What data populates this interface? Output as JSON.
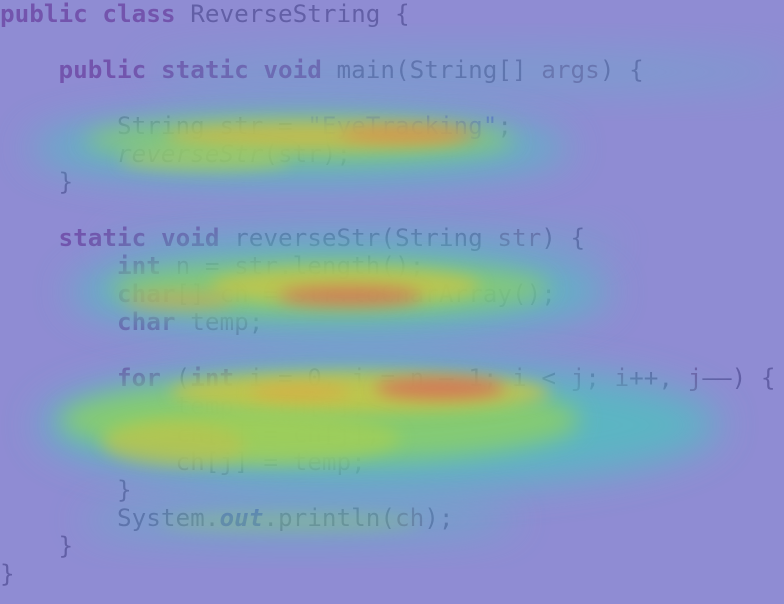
{
  "code": {
    "language": "java",
    "lines": [
      {
        "indent": "",
        "tokens": [
          {
            "t": "public",
            "k": "kw"
          },
          {
            "t": " "
          },
          {
            "t": "class",
            "k": "kw"
          },
          {
            "t": " ReverseString {"
          }
        ]
      },
      {
        "indent": "",
        "tokens": []
      },
      {
        "indent": "    ",
        "tokens": [
          {
            "t": "public",
            "k": "kw"
          },
          {
            "t": " "
          },
          {
            "t": "static",
            "k": "kw"
          },
          {
            "t": " "
          },
          {
            "t": "void",
            "k": "kw"
          },
          {
            "t": " main(String[] "
          },
          {
            "t": "args",
            "k": "var"
          },
          {
            "t": ") {"
          }
        ]
      },
      {
        "indent": "",
        "tokens": []
      },
      {
        "indent": "        ",
        "tokens": [
          {
            "t": "String "
          },
          {
            "t": "str",
            "k": "var"
          },
          {
            "t": " = "
          },
          {
            "t": "\"EyeTracking\"",
            "k": "str"
          },
          {
            "t": ";"
          }
        ]
      },
      {
        "indent": "        ",
        "tokens": [
          {
            "t": "reverseStr",
            "k": "it"
          },
          {
            "t": "("
          },
          {
            "t": "str",
            "k": "var"
          },
          {
            "t": ");"
          }
        ]
      },
      {
        "indent": "    ",
        "tokens": [
          {
            "t": "}"
          }
        ]
      },
      {
        "indent": "",
        "tokens": []
      },
      {
        "indent": "    ",
        "tokens": [
          {
            "t": "static",
            "k": "kw"
          },
          {
            "t": " "
          },
          {
            "t": "void",
            "k": "kw"
          },
          {
            "t": " reverseStr(String "
          },
          {
            "t": "str",
            "k": "var"
          },
          {
            "t": ") {"
          }
        ]
      },
      {
        "indent": "        ",
        "tokens": [
          {
            "t": "int",
            "k": "kw"
          },
          {
            "t": " "
          },
          {
            "t": "n",
            "k": "var"
          },
          {
            "t": " = "
          },
          {
            "t": "str",
            "k": "var"
          },
          {
            "t": ".length();"
          }
        ]
      },
      {
        "indent": "        ",
        "tokens": [
          {
            "t": "char",
            "k": "kw"
          },
          {
            "t": "[] "
          },
          {
            "t": "ch",
            "k": "var"
          },
          {
            "t": " = "
          },
          {
            "t": "str",
            "k": "var"
          },
          {
            "t": ".toCharArray();"
          }
        ]
      },
      {
        "indent": "        ",
        "tokens": [
          {
            "t": "char",
            "k": "kw"
          },
          {
            "t": " "
          },
          {
            "t": "temp",
            "k": "var"
          },
          {
            "t": ";"
          }
        ]
      },
      {
        "indent": "",
        "tokens": []
      },
      {
        "indent": "        ",
        "tokens": [
          {
            "t": "for",
            "k": "kw"
          },
          {
            "t": " ("
          },
          {
            "t": "int",
            "k": "kw"
          },
          {
            "t": " "
          },
          {
            "t": "i",
            "k": "var"
          },
          {
            "t": " = 0, "
          },
          {
            "t": "j",
            "k": "var"
          },
          {
            "t": " = "
          },
          {
            "t": "n",
            "k": "var"
          },
          {
            "t": " – 1; "
          },
          {
            "t": "i",
            "k": "var"
          },
          {
            "t": " < "
          },
          {
            "t": "j",
            "k": "var"
          },
          {
            "t": "; "
          },
          {
            "t": "i",
            "k": "var"
          },
          {
            "t": "++, "
          },
          {
            "t": "j",
            "k": "var"
          },
          {
            "t": "––) {"
          }
        ]
      },
      {
        "indent": "            ",
        "tokens": [
          {
            "t": "temp",
            "k": "var"
          },
          {
            "t": " = "
          },
          {
            "t": "ch",
            "k": "var"
          },
          {
            "t": "["
          },
          {
            "t": "i",
            "k": "var"
          },
          {
            "t": "];"
          }
        ]
      },
      {
        "indent": "            ",
        "tokens": [
          {
            "t": "ch",
            "k": "var"
          },
          {
            "t": "["
          },
          {
            "t": "i",
            "k": "var"
          },
          {
            "t": "] = "
          },
          {
            "t": "ch",
            "k": "var"
          },
          {
            "t": "["
          },
          {
            "t": "j",
            "k": "var"
          },
          {
            "t": "];"
          }
        ]
      },
      {
        "indent": "            ",
        "tokens": [
          {
            "t": "ch",
            "k": "var"
          },
          {
            "t": "["
          },
          {
            "t": "j",
            "k": "var"
          },
          {
            "t": "] = "
          },
          {
            "t": "temp",
            "k": "var"
          },
          {
            "t": ";"
          }
        ]
      },
      {
        "indent": "        ",
        "tokens": [
          {
            "t": "}"
          }
        ]
      },
      {
        "indent": "        ",
        "tokens": [
          {
            "t": "System."
          },
          {
            "t": "out",
            "k": "fld"
          },
          {
            "t": ".println("
          },
          {
            "t": "ch",
            "k": "var"
          },
          {
            "t": ");"
          }
        ]
      },
      {
        "indent": "    ",
        "tokens": [
          {
            "t": "}"
          }
        ]
      },
      {
        "indent": "",
        "tokens": [
          {
            "t": "}"
          }
        ]
      }
    ]
  },
  "overlay": {
    "type": "eye-tracking gaze heatmap",
    "base_tint": "#6f6cc6",
    "colors": [
      "#4fc0c0",
      "#8fd060",
      "#d0d040",
      "#e6a040",
      "#e24a5a"
    ]
  }
}
